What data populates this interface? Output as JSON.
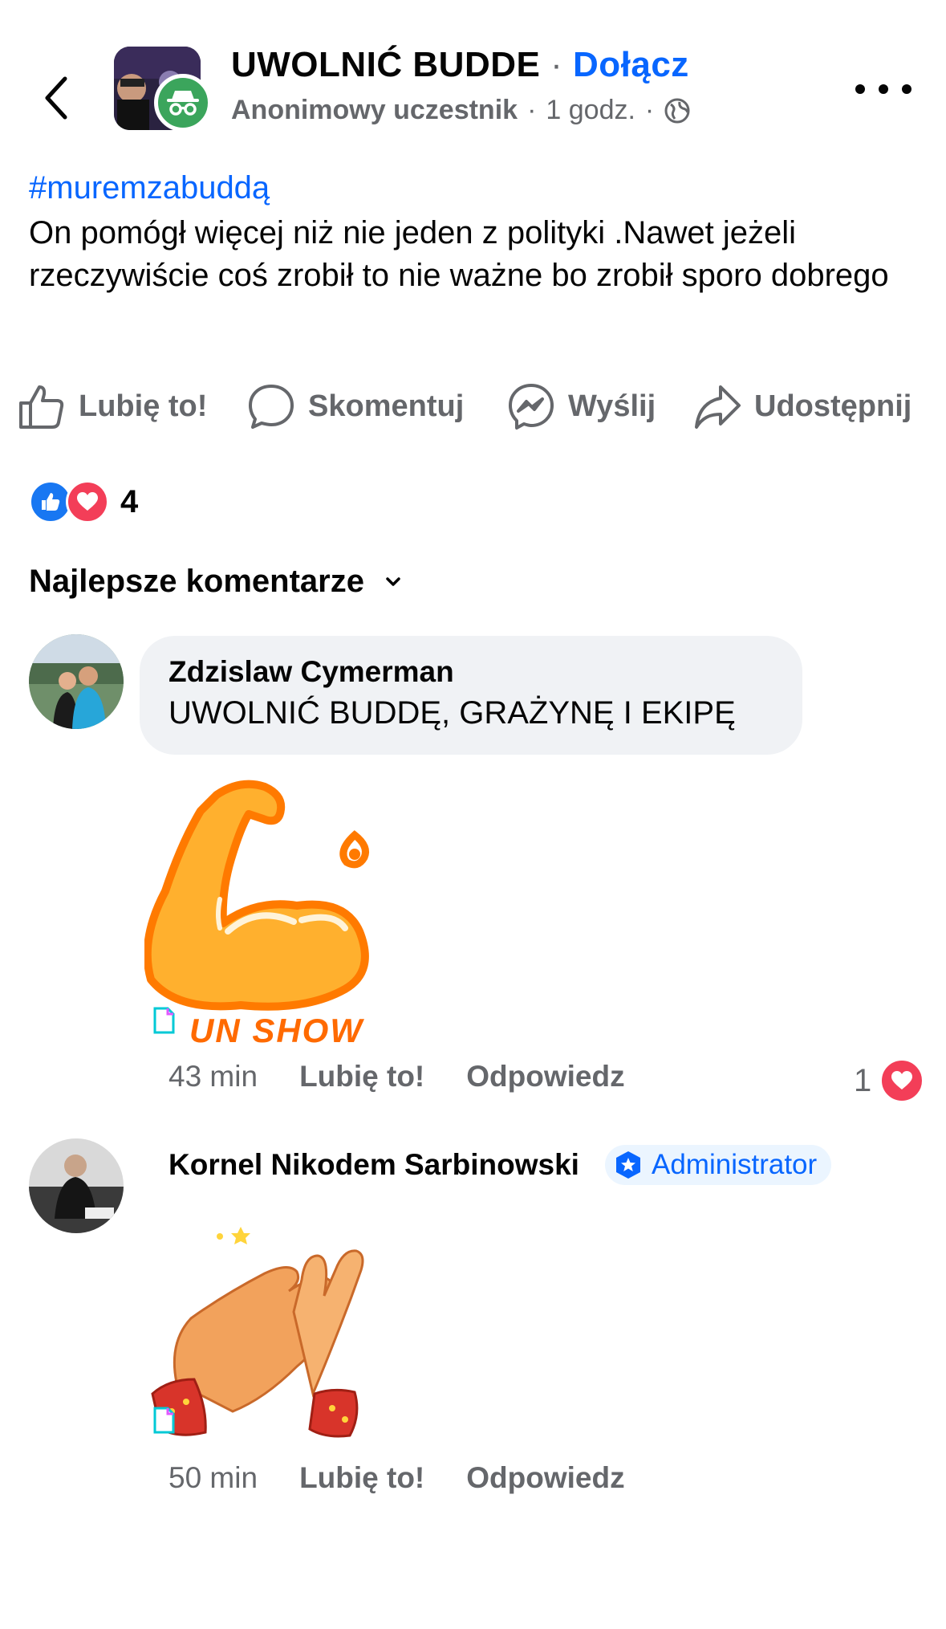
{
  "header": {
    "group_name": "UWOLNIĆ BUDDE",
    "separator": "·",
    "join_label": "Dołącz",
    "author": "Anonimowy uczestnik",
    "dot": "·",
    "time": "1 godz.",
    "dot2": "·",
    "privacy_icon": "globe-icon"
  },
  "post": {
    "hashtag": "#muremzabuddą",
    "text": "On pomógł więcej niż nie jeden z polityki .Nawet jeżeli rzeczywiście coś zrobił to nie ważne bo zrobił sporo dobrego"
  },
  "actions": {
    "like": "Lubię to!",
    "comment": "Skomentuj",
    "send": "Wyślij",
    "share": "Udostępnij"
  },
  "reactions": {
    "count": "4",
    "types": [
      "like",
      "love"
    ],
    "like_color": "#1877f2",
    "love_color": "#f33e58"
  },
  "comments_sort": {
    "label": "Najlepsze komentarze"
  },
  "comments": [
    {
      "author": "Zdzislaw Cymerman",
      "text": "UWOLNIĆ BUDDĘ, GRAŻYNĘ I EKIPĘ",
      "sticker_caption": "UN SHOW",
      "time": "43 min",
      "like": "Lubię to!",
      "reply": "Odpowiedz",
      "reaction_count": "1"
    },
    {
      "author": "Kornel Nikodem Sarbinowski",
      "badge": "Administrator",
      "time": "50 min",
      "like": "Lubię to!",
      "reply": "Odpowiedz"
    }
  ],
  "colors": {
    "accent": "#0866ff",
    "muted": "#65676b",
    "bubble": "#f0f2f5",
    "sticker_orange": "#ff7a00"
  }
}
